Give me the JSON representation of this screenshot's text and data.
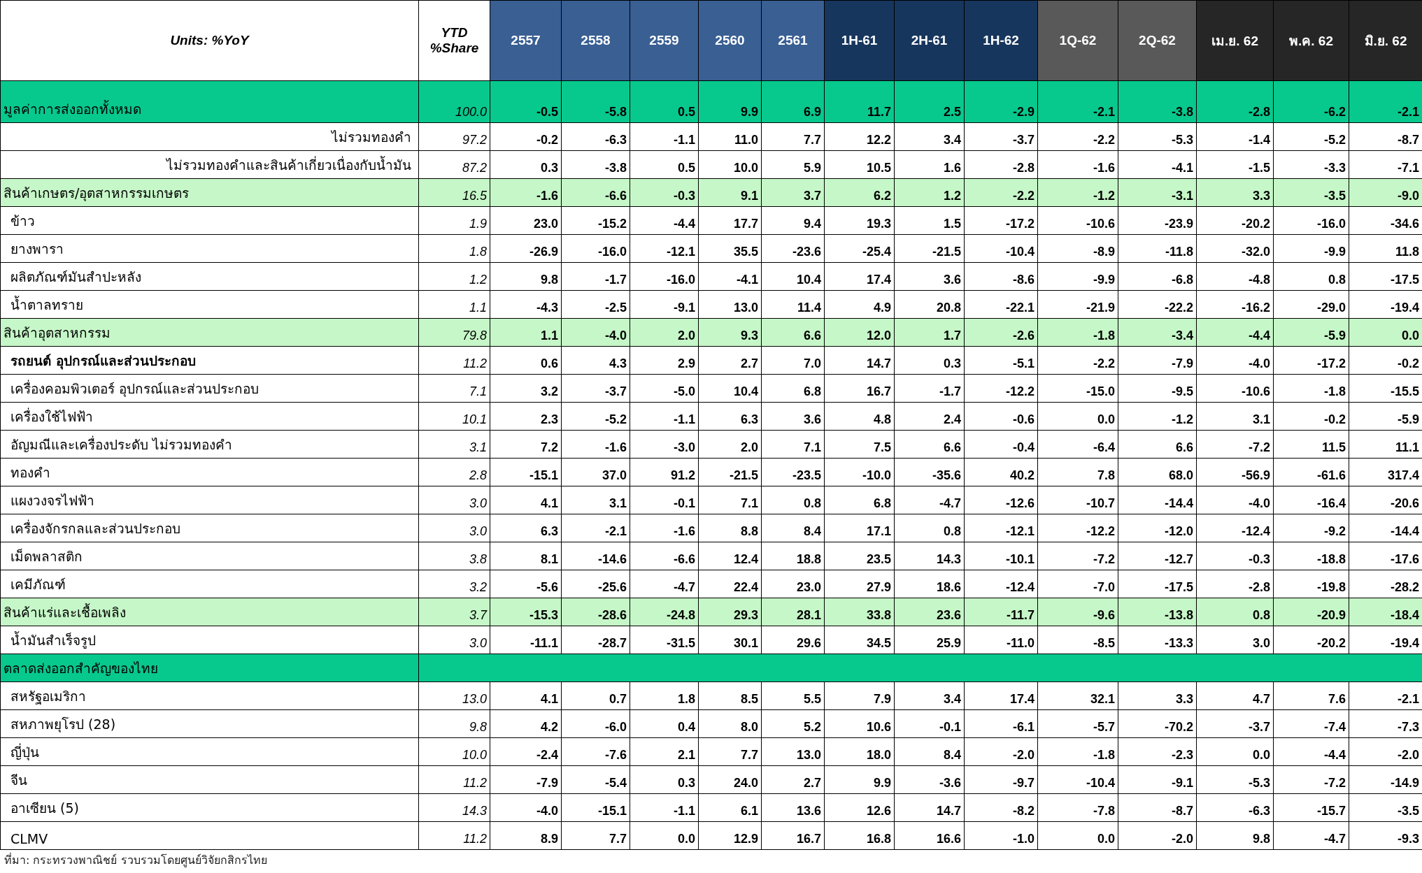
{
  "table": {
    "columns": [
      {
        "label": "Units: %YoY",
        "kind": "label"
      },
      {
        "label": "YTD %Share",
        "kind": "share"
      },
      {
        "label": "2557",
        "kind": "year"
      },
      {
        "label": "2558",
        "kind": "year"
      },
      {
        "label": "2559",
        "kind": "year"
      },
      {
        "label": "2560",
        "kind": "year"
      },
      {
        "label": "2561",
        "kind": "year"
      },
      {
        "label": "1H-61",
        "kind": "half"
      },
      {
        "label": "2H-61",
        "kind": "half"
      },
      {
        "label": "1H-62",
        "kind": "half"
      },
      {
        "label": "1Q-62",
        "kind": "quarter"
      },
      {
        "label": "2Q-62",
        "kind": "quarter"
      },
      {
        "label": "เม.ย. 62",
        "kind": "month"
      },
      {
        "label": "พ.ค. 62",
        "kind": "month"
      },
      {
        "label": "มิ.ย. 62",
        "kind": "month"
      }
    ],
    "rows": [
      {
        "kind": "total",
        "label": "มูลค่าการส่งออกทั้งหมด",
        "share": "100.0",
        "values": [
          "-0.5",
          "-5.8",
          "0.5",
          "9.9",
          "6.9",
          "11.7",
          "2.5",
          "-2.9",
          "-2.1",
          "-3.8",
          "-2.8",
          "-6.2",
          "-2.1"
        ]
      },
      {
        "kind": "subtotal",
        "label": "ไม่รวมทองคำ",
        "share": "97.2",
        "values": [
          "-0.2",
          "-6.3",
          "-1.1",
          "11.0",
          "7.7",
          "12.2",
          "3.4",
          "-3.7",
          "-2.2",
          "-5.3",
          "-1.4",
          "-5.2",
          "-8.7"
        ]
      },
      {
        "kind": "subtotal",
        "label": "ไม่รวมทองคำและสินค้าเกี่ยวเนื่องกับน้ำมัน",
        "share": "87.2",
        "values": [
          "0.3",
          "-3.8",
          "0.5",
          "10.0",
          "5.9",
          "10.5",
          "1.6",
          "-2.8",
          "-1.6",
          "-4.1",
          "-1.5",
          "-3.3",
          "-7.1"
        ]
      },
      {
        "kind": "group",
        "label": "สินค้าเกษตร/อุตสาหกรรมเกษตร",
        "share": "16.5",
        "values": [
          "-1.6",
          "-6.6",
          "-0.3",
          "9.1",
          "3.7",
          "6.2",
          "1.2",
          "-2.2",
          "-1.2",
          "-3.1",
          "3.3",
          "-3.5",
          "-9.0"
        ]
      },
      {
        "kind": "item",
        "label": "ข้าว",
        "share": "1.9",
        "values": [
          "23.0",
          "-15.2",
          "-4.4",
          "17.7",
          "9.4",
          "19.3",
          "1.5",
          "-17.2",
          "-10.6",
          "-23.9",
          "-20.2",
          "-16.0",
          "-34.6"
        ]
      },
      {
        "kind": "item",
        "label": "ยางพารา",
        "share": "1.8",
        "values": [
          "-26.9",
          "-16.0",
          "-12.1",
          "35.5",
          "-23.6",
          "-25.4",
          "-21.5",
          "-10.4",
          "-8.9",
          "-11.8",
          "-32.0",
          "-9.9",
          "11.8"
        ]
      },
      {
        "kind": "item",
        "label": "ผลิตภัณฑ์มันสำปะหลัง",
        "share": "1.2",
        "values": [
          "9.8",
          "-1.7",
          "-16.0",
          "-4.1",
          "10.4",
          "17.4",
          "3.6",
          "-8.6",
          "-9.9",
          "-6.8",
          "-4.8",
          "0.8",
          "-17.5"
        ]
      },
      {
        "kind": "item",
        "label": "น้ำตาลทราย",
        "share": "1.1",
        "values": [
          "-4.3",
          "-2.5",
          "-9.1",
          "13.0",
          "11.4",
          "4.9",
          "20.8",
          "-22.1",
          "-21.9",
          "-22.2",
          "-16.2",
          "-29.0",
          "-19.4"
        ]
      },
      {
        "kind": "group",
        "label": "สินค้าอุตสาหกรรม",
        "share": "79.8",
        "values": [
          "1.1",
          "-4.0",
          "2.0",
          "9.3",
          "6.6",
          "12.0",
          "1.7",
          "-2.6",
          "-1.8",
          "-3.4",
          "-4.4",
          "-5.9",
          "0.0"
        ]
      },
      {
        "kind": "emphasis",
        "label": "รถยนต์ อุปกรณ์และส่วนประกอบ",
        "share": "11.2",
        "values": [
          "0.6",
          "4.3",
          "2.9",
          "2.7",
          "7.0",
          "14.7",
          "0.3",
          "-5.1",
          "-2.2",
          "-7.9",
          "-4.0",
          "-17.2",
          "-0.2"
        ]
      },
      {
        "kind": "item",
        "label": "เครื่องคอมพิวเตอร์ อุปกรณ์และส่วนประกอบ",
        "share": "7.1",
        "values": [
          "3.2",
          "-3.7",
          "-5.0",
          "10.4",
          "6.8",
          "16.7",
          "-1.7",
          "-12.2",
          "-15.0",
          "-9.5",
          "-10.6",
          "-1.8",
          "-15.5"
        ]
      },
      {
        "kind": "item",
        "label": "เครื่องใช้ไฟฟ้า",
        "share": "10.1",
        "values": [
          "2.3",
          "-5.2",
          "-1.1",
          "6.3",
          "3.6",
          "4.8",
          "2.4",
          "-0.6",
          "0.0",
          "-1.2",
          "3.1",
          "-0.2",
          "-5.9"
        ]
      },
      {
        "kind": "item",
        "label": "อัญมณีและเครื่องประดับ ไม่รวมทองคำ",
        "share": "3.1",
        "values": [
          "7.2",
          "-1.6",
          "-3.0",
          "2.0",
          "7.1",
          "7.5",
          "6.6",
          "-0.4",
          "-6.4",
          "6.6",
          "-7.2",
          "11.5",
          "11.1"
        ]
      },
      {
        "kind": "item",
        "label": "ทองคำ",
        "share": "2.8",
        "values": [
          "-15.1",
          "37.0",
          "91.2",
          "-21.5",
          "-23.5",
          "-10.0",
          "-35.6",
          "40.2",
          "7.8",
          "68.0",
          "-56.9",
          "-61.6",
          "317.4"
        ]
      },
      {
        "kind": "item",
        "label": "แผงวงจรไฟฟ้า",
        "share": "3.0",
        "values": [
          "4.1",
          "3.1",
          "-0.1",
          "7.1",
          "0.8",
          "6.8",
          "-4.7",
          "-12.6",
          "-10.7",
          "-14.4",
          "-4.0",
          "-16.4",
          "-20.6"
        ]
      },
      {
        "kind": "item",
        "label": "เครื่องจักรกลและส่วนประกอบ",
        "share": "3.0",
        "values": [
          "6.3",
          "-2.1",
          "-1.6",
          "8.8",
          "8.4",
          "17.1",
          "0.8",
          "-12.1",
          "-12.2",
          "-12.0",
          "-12.4",
          "-9.2",
          "-14.4"
        ]
      },
      {
        "kind": "item",
        "label": "เม็ดพลาสติก",
        "share": "3.8",
        "values": [
          "8.1",
          "-14.6",
          "-6.6",
          "12.4",
          "18.8",
          "23.5",
          "14.3",
          "-10.1",
          "-7.2",
          "-12.7",
          "-0.3",
          "-18.8",
          "-17.6"
        ]
      },
      {
        "kind": "item",
        "label": "เคมีภัณฑ์",
        "share": "3.2",
        "values": [
          "-5.6",
          "-25.6",
          "-4.7",
          "22.4",
          "23.0",
          "27.9",
          "18.6",
          "-12.4",
          "-7.0",
          "-17.5",
          "-2.8",
          "-19.8",
          "-28.2"
        ]
      },
      {
        "kind": "group",
        "label": "สินค้าแร่และเชื้อเพลิง",
        "share": "3.7",
        "values": [
          "-15.3",
          "-28.6",
          "-24.8",
          "29.3",
          "28.1",
          "33.8",
          "23.6",
          "-11.7",
          "-9.6",
          "-13.8",
          "0.8",
          "-20.9",
          "-18.4"
        ]
      },
      {
        "kind": "item",
        "label": "น้ำมันสำเร็จรูป",
        "share": "3.0",
        "values": [
          "-11.1",
          "-28.7",
          "-31.5",
          "30.1",
          "29.6",
          "34.5",
          "25.9",
          "-11.0",
          "-8.5",
          "-13.3",
          "3.0",
          "-20.2",
          "-19.4"
        ]
      },
      {
        "kind": "section",
        "label": "ตลาดส่งออกสำคัญของไทย"
      },
      {
        "kind": "item",
        "label": "สหรัฐอเมริกา",
        "share": "13.0",
        "values": [
          "4.1",
          "0.7",
          "1.8",
          "8.5",
          "5.5",
          "7.9",
          "3.4",
          "17.4",
          "32.1",
          "3.3",
          "4.7",
          "7.6",
          "-2.1"
        ]
      },
      {
        "kind": "item",
        "label": "สหภาพยุโรป (28)",
        "share": "9.8",
        "values": [
          "4.2",
          "-6.0",
          "0.4",
          "8.0",
          "5.2",
          "10.6",
          "-0.1",
          "-6.1",
          "-5.7",
          "-70.2",
          "-3.7",
          "-7.4",
          "-7.3"
        ]
      },
      {
        "kind": "item",
        "label": "ญี่ปุ่น",
        "share": "10.0",
        "values": [
          "-2.4",
          "-7.6",
          "2.1",
          "7.7",
          "13.0",
          "18.0",
          "8.4",
          "-2.0",
          "-1.8",
          "-2.3",
          "0.0",
          "-4.4",
          "-2.0"
        ]
      },
      {
        "kind": "item",
        "label": "จีน",
        "share": "11.2",
        "values": [
          "-7.9",
          "-5.4",
          "0.3",
          "24.0",
          "2.7",
          "9.9",
          "-3.6",
          "-9.7",
          "-10.4",
          "-9.1",
          "-5.3",
          "-7.2",
          "-14.9"
        ]
      },
      {
        "kind": "item",
        "label": "อาเซียน (5)",
        "share": "14.3",
        "values": [
          "-4.0",
          "-15.1",
          "-1.1",
          "6.1",
          "13.6",
          "12.6",
          "14.7",
          "-8.2",
          "-7.8",
          "-8.7",
          "-6.3",
          "-15.7",
          "-3.5"
        ]
      },
      {
        "kind": "item",
        "label": "CLMV",
        "share": "11.2",
        "values": [
          "8.9",
          "7.7",
          "0.0",
          "12.9",
          "16.7",
          "16.8",
          "16.6",
          "-1.0",
          "0.0",
          "-2.0",
          "9.8",
          "-4.7",
          "-9.3"
        ]
      }
    ]
  },
  "source_note": "ที่มา: กระทรวงพาณิชย์ รวบรวมโดยศูนย์วิจัยกสิกรไทย"
}
